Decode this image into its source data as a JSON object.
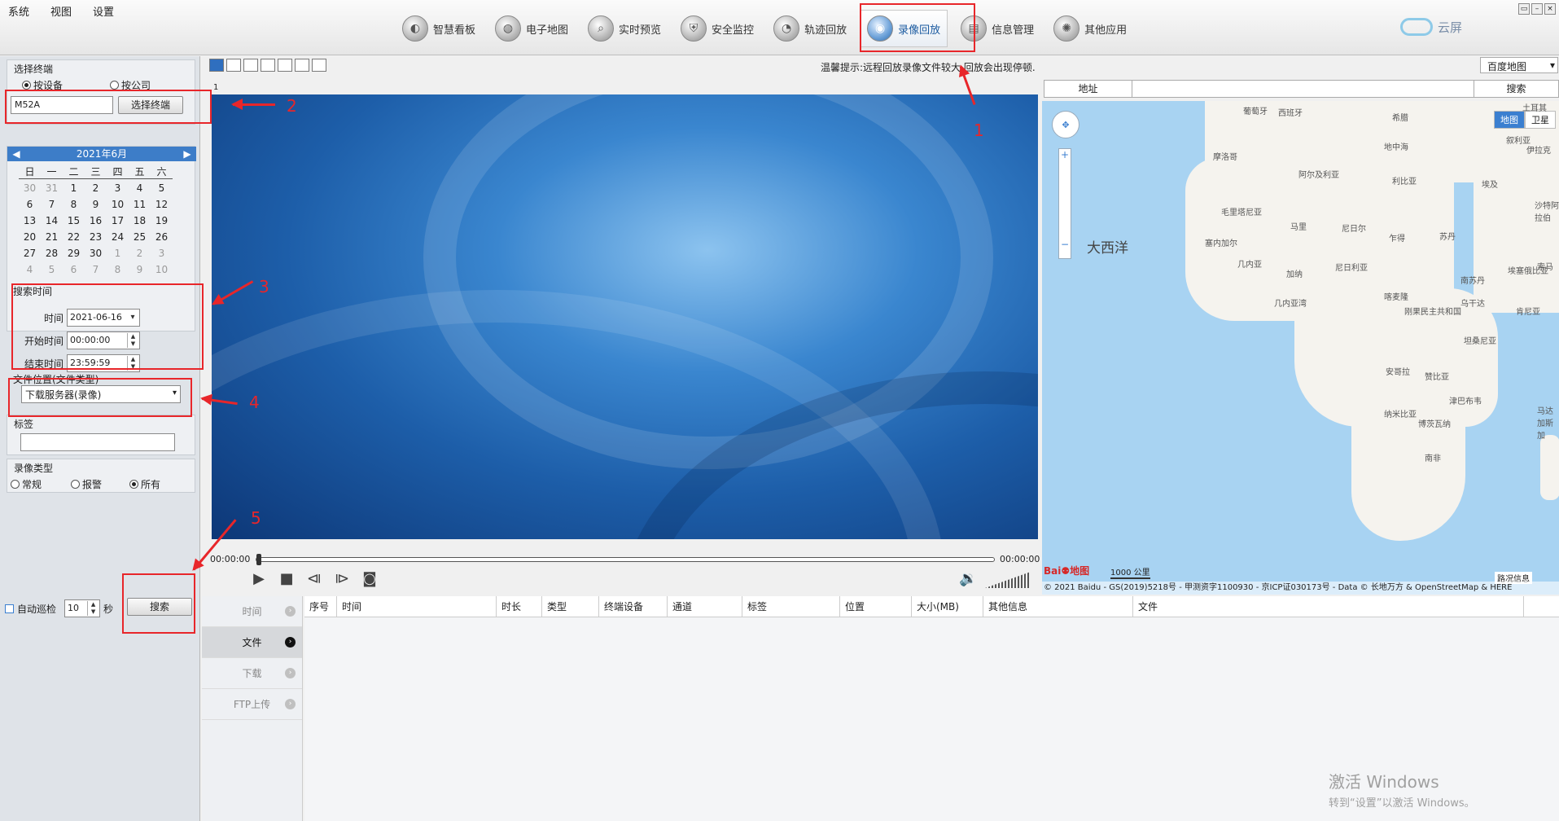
{
  "menu": [
    "系统",
    "视图",
    "设置"
  ],
  "nav": [
    {
      "label": "智慧看板",
      "icon": "dashboard-icon",
      "glyph": "◐"
    },
    {
      "label": "电子地图",
      "icon": "map-icon",
      "glyph": "◍"
    },
    {
      "label": "实时预览",
      "icon": "search-icon",
      "glyph": "⌕"
    },
    {
      "label": "安全监控",
      "icon": "shield-icon",
      "glyph": "⛨"
    },
    {
      "label": "轨迹回放",
      "icon": "track-icon",
      "glyph": "◔"
    },
    {
      "label": "录像回放",
      "icon": "camera-icon",
      "glyph": "◉",
      "active": true
    },
    {
      "label": "信息管理",
      "icon": "info-icon",
      "glyph": "▤"
    },
    {
      "label": "其他应用",
      "icon": "apps-icon",
      "glyph": "✺"
    }
  ],
  "brand": {
    "label": "云屏"
  },
  "left": {
    "terminal": {
      "title": "选择终端",
      "by_device": "按设备",
      "by_company": "按公司",
      "device_value": "M52A",
      "select_button": "选择终端"
    },
    "calendar": {
      "month": "2021年6月",
      "weekdays": [
        "日",
        "一",
        "二",
        "三",
        "四",
        "五",
        "六"
      ],
      "days": [
        [
          "30",
          "31",
          "1",
          "2",
          "3",
          "4",
          "5"
        ],
        [
          "6",
          "7",
          "8",
          "9",
          "10",
          "11",
          "12"
        ],
        [
          "13",
          "14",
          "15",
          "16",
          "17",
          "18",
          "19"
        ],
        [
          "20",
          "21",
          "22",
          "23",
          "24",
          "25",
          "26"
        ],
        [
          "27",
          "28",
          "29",
          "30",
          "1",
          "2",
          "3"
        ],
        [
          "4",
          "5",
          "6",
          "7",
          "8",
          "9",
          "10"
        ]
      ]
    },
    "search_time": {
      "title": "搜索时间",
      "date_label": "时间",
      "date_value": "2021-06-16",
      "start_label": "开始时间",
      "start_value": "00:00:00",
      "end_label": "结束时间",
      "end_value": "23:59:59"
    },
    "file_location": {
      "title": "文件位置(文件类型)",
      "value": "下载服务器(录像)"
    },
    "tag": {
      "title": "标签",
      "value": ""
    },
    "record_type": {
      "title": "录像类型",
      "options": [
        "常规",
        "报警",
        "所有"
      ],
      "selected": "所有"
    },
    "auto_patrol": {
      "label": "自动巡检",
      "value": "10",
      "unit": "秒"
    },
    "search_button": "搜索"
  },
  "center": {
    "tip": "温馨提示:远程回放录像文件较大,回放会出现停顿.",
    "video_index": "1",
    "time_start": "00:00:00",
    "time_end": "00:00:00"
  },
  "map": {
    "provider": "百度地图",
    "address_label": "地址",
    "search_label": "搜索",
    "type_map": "地图",
    "type_satellite": "卫星",
    "ocean": "大西洋",
    "labels": [
      "葡萄牙",
      "西班牙",
      "土耳其",
      "摩洛哥",
      "阿尔及利亚",
      "利比亚",
      "埃及",
      "希腊",
      "叙利亚",
      "伊拉克",
      "沙特阿拉伯",
      "毛里塔尼亚",
      "马里",
      "尼日尔",
      "乍得",
      "苏丹",
      "塞内加尔",
      "几内亚",
      "加纳",
      "尼日利亚",
      "喀麦隆",
      "南苏丹",
      "埃塞俄比亚",
      "刚果民主共和国",
      "乌干达",
      "肯尼亚",
      "坦桑尼亚",
      "安哥拉",
      "赞比亚",
      "津巴布韦",
      "纳米比亚",
      "博茨瓦纳",
      "南非",
      "马达加斯加",
      "几内亚湾",
      "地中海",
      "索马"
    ],
    "scale": "1000 公里",
    "traffic": "路况信息",
    "footer": "© 2021 Baidu - GS(2019)5218号 - 甲测资字1100930 - 京ICP证030173号 - Data © 长地万方 & OpenStreetMap & HERE"
  },
  "bottom": {
    "tabs": [
      {
        "label": "时间",
        "active": false
      },
      {
        "label": "文件",
        "active": true
      },
      {
        "label": "下载",
        "active": false
      },
      {
        "label": "FTP上传",
        "active": false
      }
    ],
    "columns": [
      "序号",
      "时间",
      "时长",
      "类型",
      "终端设备",
      "通道",
      "标签",
      "位置",
      "大小(MB)",
      "其他信息",
      "文件"
    ]
  },
  "annotations": [
    "1",
    "2",
    "3",
    "4",
    "5"
  ],
  "watermark": {
    "line1": "激活 Windows",
    "line2": "转到“设置”以激活 Windows。"
  },
  "colors": {
    "accent": "#3b7fd0",
    "annotation": "#e8262a"
  }
}
